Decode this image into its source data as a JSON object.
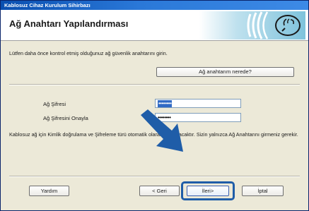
{
  "window": {
    "title": "Kablosuz Cihaz Kurulum Sihirbazı"
  },
  "header": {
    "title": "Ağ Anahtarı Yapılandırması",
    "logo_icon": "wireless-signal-icon"
  },
  "main": {
    "instruction": "Lütfen daha önce kontrol etmiş olduğunuz ağ güvenlik anahtarını girin.",
    "locate_button": "Ağ anahtarım nerede?",
    "fields": {
      "key_label": "Ağ Şifresi",
      "key_value": "••••••••",
      "confirm_label": "Ağ Şifresini Onayla",
      "confirm_value": "••••••••"
    },
    "info": "Kablosuz ağ için Kimlik doğrulama ve Şifreleme türü otomatik olarak algılanacaktır. Sizin yalnızca Ağ Anahtarını girmeniz gerekir."
  },
  "footer": {
    "help": "Yardım",
    "back": "< Geri",
    "next": "İleri>",
    "cancel": "İptal"
  },
  "colors": {
    "accent": "#1f5da8",
    "titlebar": "#0a4fb0"
  }
}
